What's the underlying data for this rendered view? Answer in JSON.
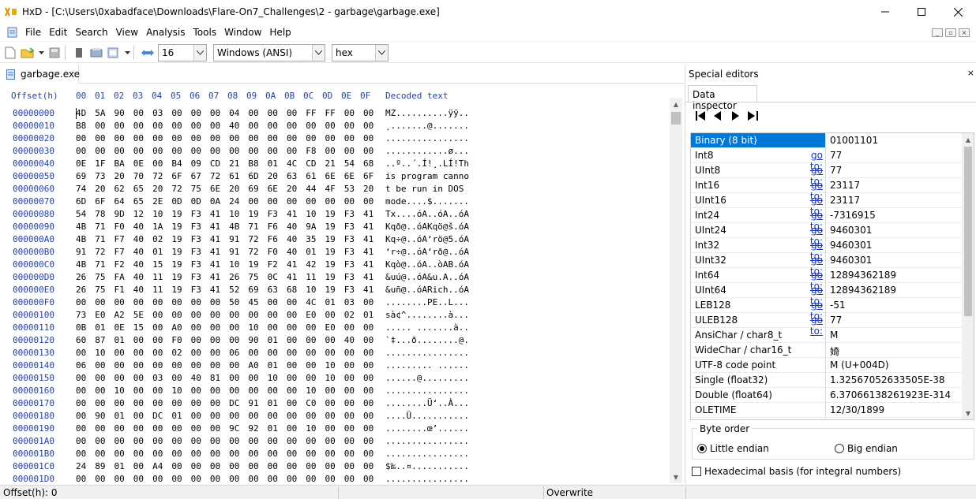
{
  "window": {
    "title": "HxD - [C:\\Users\\0xabadface\\Downloads\\Flare-On7_Challenges\\2 - garbage\\garbage.exe]"
  },
  "menu": [
    "File",
    "Edit",
    "Search",
    "View",
    "Analysis",
    "Tools",
    "Window",
    "Help"
  ],
  "toolbar": {
    "bytes_per_row": "16",
    "charset": "Windows (ANSI)",
    "offset_base": "hex"
  },
  "doc_tab": "garbage.exe",
  "editor": {
    "offset_header": "Offset(h)",
    "col_headers": [
      "00",
      "01",
      "02",
      "03",
      "04",
      "05",
      "06",
      "07",
      "08",
      "09",
      "0A",
      "0B",
      "0C",
      "0D",
      "0E",
      "0F"
    ],
    "decoded_header": "Decoded text",
    "rows": [
      {
        "off": "00000000",
        "hex": "4D 5A 90 00 03 00 00 00 04 00 00 00 FF FF 00 00",
        "dec": "MZ..........ÿÿ.."
      },
      {
        "off": "00000010",
        "hex": "B8 00 00 00 00 00 00 00 40 00 00 00 00 00 00 00",
        "dec": "¸.......@......."
      },
      {
        "off": "00000020",
        "hex": "00 00 00 00 00 00 00 00 00 00 00 00 00 00 00 00",
        "dec": "................"
      },
      {
        "off": "00000030",
        "hex": "00 00 00 00 00 00 00 00 00 00 00 00 F8 00 00 00",
        "dec": "............ø..."
      },
      {
        "off": "00000040",
        "hex": "0E 1F BA 0E 00 B4 09 CD 21 B8 01 4C CD 21 54 68",
        "dec": "..º..´.Í!¸.LÍ!Th"
      },
      {
        "off": "00000050",
        "hex": "69 73 20 70 72 6F 67 72 61 6D 20 63 61 6E 6E 6F",
        "dec": "is program canno"
      },
      {
        "off": "00000060",
        "hex": "74 20 62 65 20 72 75 6E 20 69 6E 20 44 4F 53 20",
        "dec": "t be run in DOS "
      },
      {
        "off": "00000070",
        "hex": "6D 6F 64 65 2E 0D 0D 0A 24 00 00 00 00 00 00 00",
        "dec": "mode....$......."
      },
      {
        "off": "00000080",
        "hex": "54 78 9D 12 10 19 F3 41 10 19 F3 41 10 19 F3 41",
        "dec": "Tx....óA..óA..óA"
      },
      {
        "off": "00000090",
        "hex": "4B 71 F0 40 1A 19 F3 41 4B 71 F6 40 9A 19 F3 41",
        "dec": "Kqð@..óAKqö@š.óA"
      },
      {
        "off": "000000A0",
        "hex": "4B 71 F7 40 02 19 F3 41 91 72 F6 40 35 19 F3 41",
        "dec": "Kq÷@..óA‘rö@5.óA"
      },
      {
        "off": "000000B0",
        "hex": "91 72 F7 40 01 19 F3 41 91 72 F0 40 01 19 F3 41",
        "dec": "‘r÷@..óA‘rð@..óA"
      },
      {
        "off": "000000C0",
        "hex": "4B 71 F2 40 15 19 F3 41 10 19 F2 41 42 19 F3 41",
        "dec": "Kqò@..óA..òAB.óA"
      },
      {
        "off": "000000D0",
        "hex": "26 75 FA 40 11 19 F3 41 26 75 0C 41 11 19 F3 41",
        "dec": "&uú@..óA&u.A..óA"
      },
      {
        "off": "000000E0",
        "hex": "26 75 F1 40 11 19 F3 41 52 69 63 68 10 19 F3 41",
        "dec": "&uñ@..óARich..óA"
      },
      {
        "off": "000000F0",
        "hex": "00 00 00 00 00 00 00 00 50 45 00 00 4C 01 03 00",
        "dec": "........PE..L..."
      },
      {
        "off": "00000100",
        "hex": "73 E0 A2 5E 00 00 00 00 00 00 00 00 E0 00 02 01",
        "dec": "sà¢^........à..."
      },
      {
        "off": "00000110",
        "hex": "0B 01 0E 15 00 A0 00 00 00 10 00 00 00 E0 00 00",
        "dec": "..... .......à.."
      },
      {
        "off": "00000120",
        "hex": "60 87 01 00 00 F0 00 00 00 90 01 00 00 00 40 00",
        "dec": "`‡...ð........@."
      },
      {
        "off": "00000130",
        "hex": "00 10 00 00 00 02 00 00 06 00 00 00 00 00 00 00",
        "dec": "................"
      },
      {
        "off": "00000140",
        "hex": "06 00 00 00 00 00 00 00 00 A0 01 00 00 10 00 00",
        "dec": "......... ......"
      },
      {
        "off": "00000150",
        "hex": "00 00 00 00 03 00 40 81 00 00 10 00 00 10 00 00",
        "dec": "......@........."
      },
      {
        "off": "00000160",
        "hex": "00 00 10 00 00 10 00 00 00 00 00 00 10 00 00 00",
        "dec": "................"
      },
      {
        "off": "00000170",
        "hex": "00 00 00 00 00 00 00 00 DC 91 01 00 C0 00 00 00",
        "dec": "........Ü‘..À..."
      },
      {
        "off": "00000180",
        "hex": "00 90 01 00 DC 01 00 00 00 00 00 00 00 00 00 00",
        "dec": "....Ü..........."
      },
      {
        "off": "00000190",
        "hex": "00 00 00 00 00 00 00 00 9C 92 01 00 10 00 00 00",
        "dec": "........œ’......"
      },
      {
        "off": "000001A0",
        "hex": "00 00 00 00 00 00 00 00 00 00 00 00 00 00 00 00",
        "dec": "................"
      },
      {
        "off": "000001B0",
        "hex": "00 00 00 00 00 00 00 00 00 00 00 00 00 00 00 00",
        "dec": "................"
      },
      {
        "off": "000001C0",
        "hex": "24 89 01 00 A4 00 00 00 00 00 00 00 00 00 00 00",
        "dec": "$‰..¤..........."
      },
      {
        "off": "000001D0",
        "hex": "00 00 00 00 00 00 00 00 00 00 00 00 00 00 00 00",
        "dec": "................"
      }
    ]
  },
  "special_editors": {
    "title": "Special editors",
    "close": "×",
    "tab": "Data inspector",
    "goto_label": "go to:",
    "rows": [
      {
        "name": "Binary (8 bit)",
        "goto": false,
        "value": "01001101"
      },
      {
        "name": "Int8",
        "goto": true,
        "value": "77"
      },
      {
        "name": "UInt8",
        "goto": true,
        "value": "77"
      },
      {
        "name": "Int16",
        "goto": true,
        "value": "23117"
      },
      {
        "name": "UInt16",
        "goto": true,
        "value": "23117"
      },
      {
        "name": "Int24",
        "goto": true,
        "value": "-7316915"
      },
      {
        "name": "UInt24",
        "goto": true,
        "value": "9460301"
      },
      {
        "name": "Int32",
        "goto": true,
        "value": "9460301"
      },
      {
        "name": "UInt32",
        "goto": true,
        "value": "9460301"
      },
      {
        "name": "Int64",
        "goto": true,
        "value": "12894362189"
      },
      {
        "name": "UInt64",
        "goto": true,
        "value": "12894362189"
      },
      {
        "name": "LEB128",
        "goto": true,
        "value": "-51"
      },
      {
        "name": "ULEB128",
        "goto": true,
        "value": "77"
      },
      {
        "name": "AnsiChar / char8_t",
        "goto": false,
        "value": "M"
      },
      {
        "name": "WideChar / char16_t",
        "goto": false,
        "value": "婍"
      },
      {
        "name": "UTF-8 code point",
        "goto": false,
        "value": "M (U+004D)"
      },
      {
        "name": "Single (float32)",
        "goto": false,
        "value": "1.32567052633505E-38"
      },
      {
        "name": "Double (float64)",
        "goto": false,
        "value": "6.37066138261923E-314"
      },
      {
        "name": "OLETIME",
        "goto": false,
        "value": "12/30/1899"
      }
    ],
    "byte_order_label": "Byte order",
    "little_endian": "Little endian",
    "big_endian": "Big endian",
    "hex_basis": "Hexadecimal basis (for integral numbers)"
  },
  "status": {
    "offset": "Offset(h): 0",
    "mode": "Overwrite"
  },
  "colors": {
    "offset_blue": "#1f3fae",
    "selection": "#0078d7",
    "zero_grey": "#9a9a9a",
    "link": "#1a35b8"
  }
}
